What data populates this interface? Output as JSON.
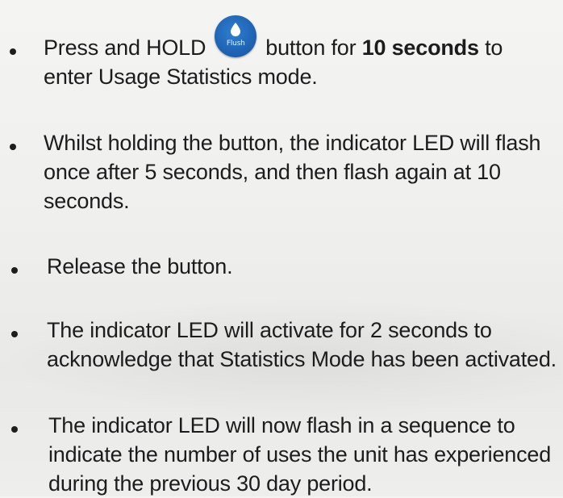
{
  "bullets": [
    {
      "lines": [
        {
          "before": "Press and HOLD",
          "after_icon": "button for ",
          "bold": "10 seconds",
          "after_bold": " to"
        },
        "enter Usage Statistics mode."
      ]
    },
    {
      "lines": [
        "Whilst holding the button, the indicator LED will flash",
        "once after 5 seconds, and then flash again at 10",
        "seconds."
      ]
    },
    {
      "lines": [
        "Release the button."
      ]
    },
    {
      "lines": [
        "The indicator LED will activate for 2 seconds to",
        "acknowledge that Statistics Mode has been activated."
      ]
    },
    {
      "lines": [
        "The indicator LED will now flash in a sequence to",
        "indicate the number of uses the unit has experienced",
        "during the previous 30 day period."
      ]
    }
  ],
  "flush_button": {
    "label": "Flush",
    "icon": "water-drop-icon",
    "color": "#1c5fae"
  }
}
